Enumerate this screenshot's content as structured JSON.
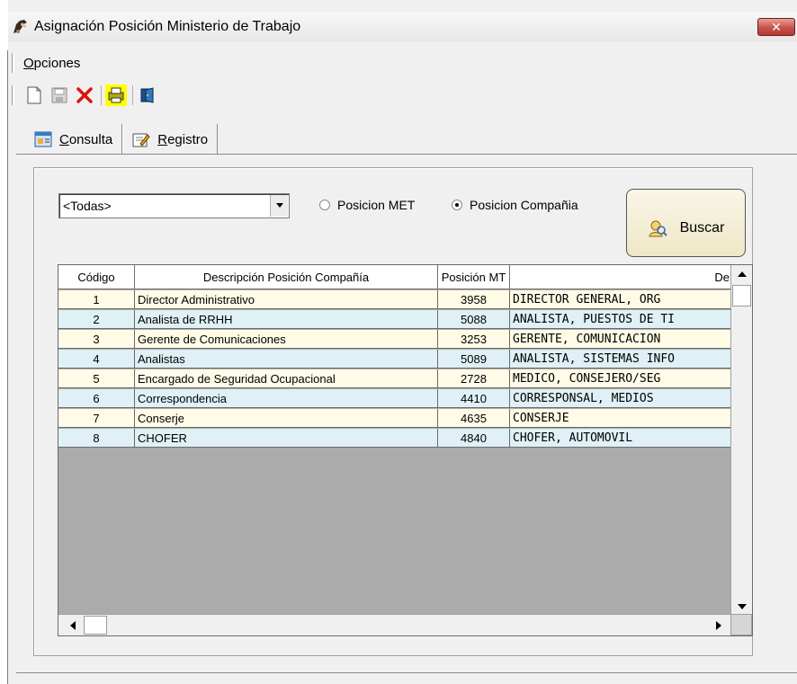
{
  "window": {
    "title": "Asignación Posición Ministerio de Trabajo",
    "close_label": "✕"
  },
  "menu": {
    "opciones_first": "O",
    "opciones_rest": "pciones"
  },
  "toolbar": {
    "icons": [
      "new-document-icon",
      "save-icon",
      "delete-icon",
      "print-icon",
      "exit-icon"
    ]
  },
  "tabs": [
    {
      "first": "C",
      "rest": "onsulta",
      "icon": "form-icon",
      "active": true
    },
    {
      "first": "R",
      "rest": "egistro",
      "icon": "edit-icon",
      "active": false
    }
  ],
  "filter": {
    "combo_value": "<Todas>",
    "radio_met": "Posicion MET",
    "radio_compania": "Posicion Compañia",
    "selected": "compania",
    "buscar_label": "Buscar"
  },
  "grid": {
    "headers": [
      "Código",
      "Descripción Posición Compañía",
      "Posición MT",
      "De"
    ],
    "rows": [
      {
        "codigo": "1",
        "descripcion": "Director Administrativo",
        "posicion": "3958",
        "desc_mt": "DIRECTOR GENERAL, ORG"
      },
      {
        "codigo": "2",
        "descripcion": "Analista de RRHH",
        "posicion": "5088",
        "desc_mt": "ANALISTA, PUESTOS DE TI"
      },
      {
        "codigo": "3",
        "descripcion": "Gerente de Comunicaciones",
        "posicion": "3253",
        "desc_mt": "GERENTE, COMUNICACION"
      },
      {
        "codigo": "4",
        "descripcion": "Analistas",
        "posicion": "5089",
        "desc_mt": "ANALISTA, SISTEMAS INFO"
      },
      {
        "codigo": "5",
        "descripcion": "Encargado de Seguridad Ocupacional",
        "posicion": "2728",
        "desc_mt": "MEDICO, CONSEJERO/SEG"
      },
      {
        "codigo": "6",
        "descripcion": "Correspondencia",
        "posicion": "4410",
        "desc_mt": "CORRESPONSAL, MEDIOS"
      },
      {
        "codigo": "7",
        "descripcion": "Conserje",
        "posicion": "4635",
        "desc_mt": "CONSERJE"
      },
      {
        "codigo": "8",
        "descripcion": "CHOFER",
        "posicion": "4840",
        "desc_mt": "CHOFER, AUTOMOVIL"
      }
    ]
  }
}
